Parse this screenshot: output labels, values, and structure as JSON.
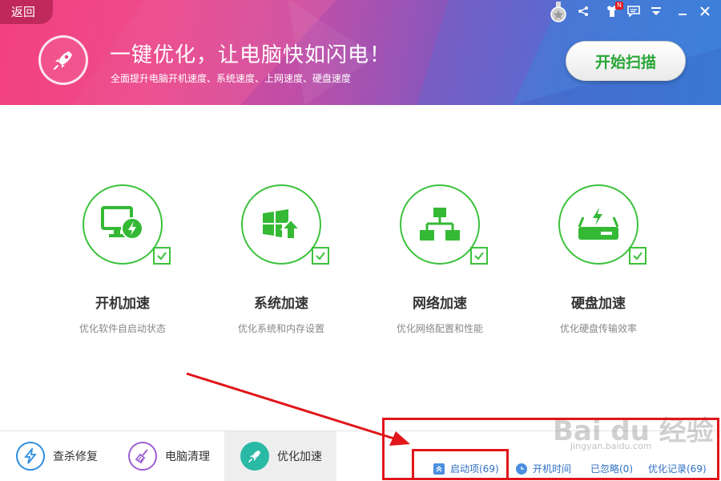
{
  "header": {
    "back_label": "返回",
    "title": "一键优化，让电脑快如闪电！",
    "subtitle": "全面提升电脑开机速度、系统速度、上网速度、硬盘速度",
    "scan_button": "开始扫描",
    "badge_letter": "N"
  },
  "features": [
    {
      "title": "开机加速",
      "desc": "优化软件自启动状态",
      "icon": "monitor-bolt-icon"
    },
    {
      "title": "系统加速",
      "desc": "优化系统和内存设置",
      "icon": "windows-upgrade-icon"
    },
    {
      "title": "网络加速",
      "desc": "优化网络配置和性能",
      "icon": "network-topology-icon"
    },
    {
      "title": "硬盘加速",
      "desc": "优化硬盘传输效率",
      "icon": "hard-disk-bolt-icon"
    }
  ],
  "tabs": [
    {
      "label": "查杀修复",
      "icon": "bolt-icon",
      "color": "#2d8ee0"
    },
    {
      "label": "电脑清理",
      "icon": "broom-icon",
      "color": "#9b5fd1"
    },
    {
      "label": "优化加速",
      "icon": "rocket-icon",
      "color": "#2ab9a4"
    }
  ],
  "status": {
    "startup": "启动项(69)",
    "boot_time": "开机时间",
    "ignored": "已忽略(0)",
    "history": "优化记录(69)"
  },
  "watermark": {
    "brand": "Bai du 经验",
    "url": "jingyan.baidu.com"
  },
  "colors": {
    "accent_green": "#3cc23c",
    "annotation_red": "#e0161b",
    "link_blue": "#2f6fc2"
  }
}
